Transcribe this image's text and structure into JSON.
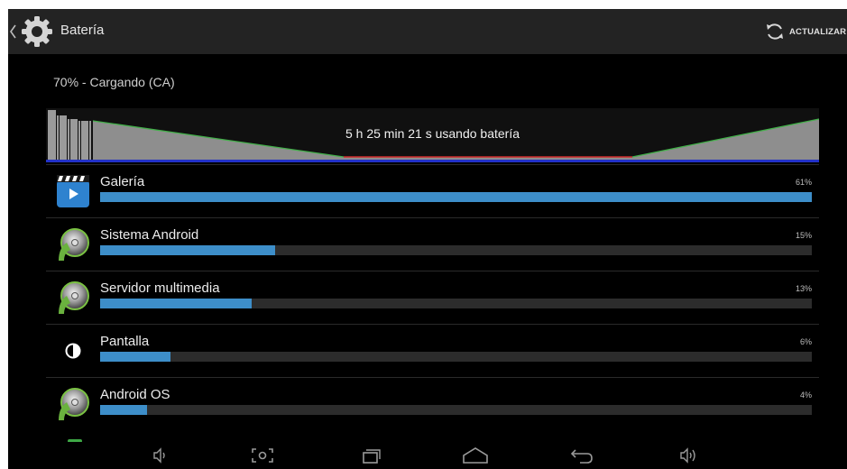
{
  "action_bar": {
    "title": "Batería",
    "refresh_label": "ACTUALIZAR",
    "icons": [
      "up-caret-icon",
      "settings-gear-icon",
      "refresh-icon"
    ]
  },
  "battery": {
    "status": "70% - Cargando (CA)",
    "graph_label": "5 h 25 min 21 s usando batería"
  },
  "apps": [
    {
      "name": "Galería",
      "percent_label": "61%",
      "percent": 61,
      "icon": "gallery-icon"
    },
    {
      "name": "Sistema Android",
      "percent_label": "15%",
      "percent": 15,
      "icon": "android-system-icon"
    },
    {
      "name": "Servidor multimedia",
      "percent_label": "13%",
      "percent": 13,
      "icon": "android-system-icon"
    },
    {
      "name": "Pantalla",
      "percent_label": "6%",
      "percent": 6,
      "icon": "brightness-icon"
    },
    {
      "name": "Android OS",
      "percent_label": "4%",
      "percent": 4,
      "icon": "android-system-icon"
    }
  ],
  "nav_bar": {
    "icons": [
      "volume-down-icon",
      "screenshot-icon",
      "recent-apps-icon",
      "home-icon",
      "back-icon",
      "volume-up-icon"
    ]
  },
  "colors": {
    "accent": "#3d8ec9",
    "bar_track": "#2c2c2c",
    "action_bar": "#232323",
    "background": "#000000"
  }
}
